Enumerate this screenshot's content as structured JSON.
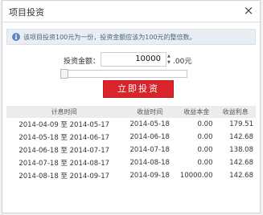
{
  "dialog": {
    "title": "项目投资",
    "close_label": "×"
  },
  "notice": {
    "text": "该项目投资100元为一份，投资金额应该为100元的整倍数。"
  },
  "form": {
    "amount_label": "投资金额：",
    "amount_value": "10000",
    "unit": ".00元",
    "slider_fraction": 0.0
  },
  "invest_button": {
    "label": "立即投资"
  },
  "table": {
    "headers": [
      "计息时间",
      "收益时间",
      "收益本金",
      "收益利息"
    ],
    "rows": [
      [
        "2014-04-09 至 2014-05-17",
        "2014-05-18",
        "0.00",
        "179.51"
      ],
      [
        "2014-05-18 至 2014-06-17",
        "2014-06-18",
        "0.00",
        "142.68"
      ],
      [
        "2014-06-18 至 2014-07-17",
        "2014-07-18",
        "0.00",
        "138.08"
      ],
      [
        "2014-07-18 至 2014-08-17",
        "2014-08-18",
        "0.00",
        "142.68"
      ],
      [
        "2014-08-18 至 2014-09-17",
        "2014-09-18",
        "10000.00",
        "142.68"
      ]
    ]
  }
}
